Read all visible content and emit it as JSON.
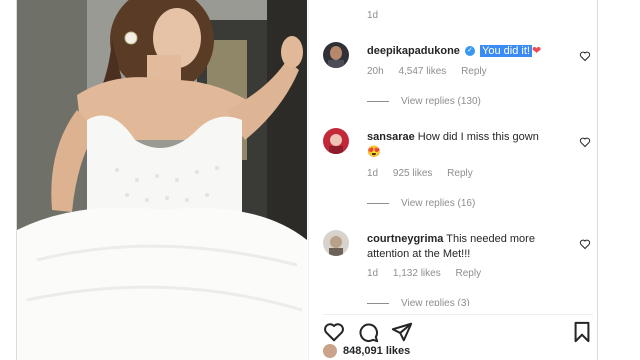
{
  "post": {
    "top_time": "1d",
    "likes_count": "848,091 likes"
  },
  "comments": [
    {
      "username": "deepikapadukone",
      "verified": true,
      "text": "You did it!",
      "emoji": "❤",
      "time": "20h",
      "likes": "4,547 likes",
      "reply": "Reply",
      "view_replies": "View replies (130)"
    },
    {
      "username": "sansarae",
      "verified": false,
      "text": "How did I miss this gown",
      "emoji": "😍",
      "time": "1d",
      "likes": "925 likes",
      "reply": "Reply",
      "view_replies": "View replies (16)"
    },
    {
      "username": "courtneygrima",
      "verified": false,
      "text": "This needed more attention at the Met!!!",
      "time": "1d",
      "likes": "1,132 likes",
      "reply": "Reply",
      "view_replies": "View replies (3)"
    }
  ],
  "icons": {
    "like": "heart-outline-icon",
    "comment": "speech-bubble-icon",
    "share": "paper-plane-icon",
    "save": "bookmark-icon",
    "comment_like": "heart-outline-icon",
    "verified": "verified-badge-icon"
  },
  "colors": {
    "highlight": "#3b8bf4",
    "verified": "#3897f0",
    "heart_red": "#ed4956",
    "secondary_text": "#8e8e8e"
  }
}
